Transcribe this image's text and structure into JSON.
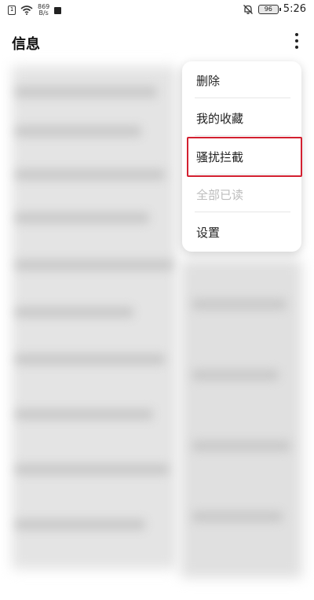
{
  "statusbar": {
    "net_speed_value": "869",
    "net_speed_unit": "B/s",
    "battery": "96",
    "time": "5:26"
  },
  "header": {
    "title": "信息"
  },
  "menu": {
    "items": [
      {
        "label": "删除",
        "enabled": true
      },
      {
        "label": "我的收藏",
        "enabled": true
      },
      {
        "label": "骚扰拦截",
        "enabled": true,
        "highlighted": true
      },
      {
        "label": "全部已读",
        "enabled": false
      },
      {
        "label": "设置",
        "enabled": true
      }
    ]
  },
  "colors": {
    "highlight": "#d32030",
    "disabled_text": "#bdbdbd"
  },
  "icons": [
    "sim-icon",
    "wifi-icon",
    "notification-icon",
    "mute-bell-icon",
    "battery-icon",
    "more-vertical-icon"
  ]
}
